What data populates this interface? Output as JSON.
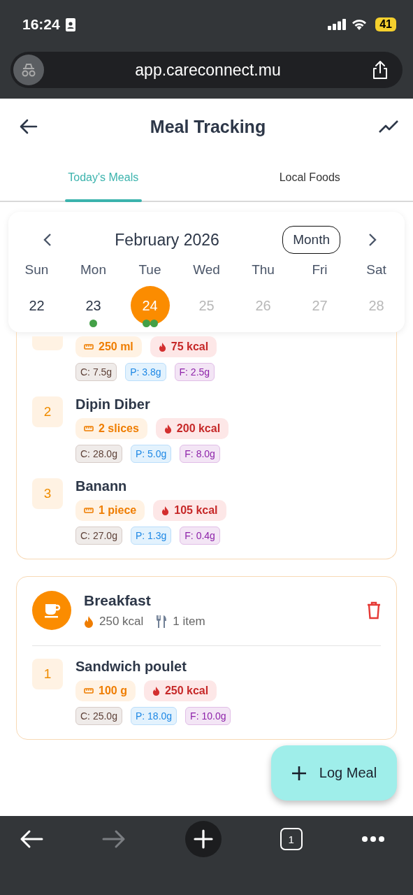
{
  "status_bar": {
    "time": "16:24",
    "battery": "41"
  },
  "browser": {
    "url": "app.careconnect.mu",
    "tab_count": "1"
  },
  "header": {
    "title": "Meal Tracking"
  },
  "tabs": [
    {
      "label": "Today's Meals",
      "selected": true
    },
    {
      "label": "Local Foods",
      "selected": false
    }
  ],
  "calendar": {
    "month": "February 2026",
    "view_button": "Month",
    "days": [
      {
        "weekday": "Sun",
        "date": "22",
        "selected": false,
        "disabled": false
      },
      {
        "weekday": "Mon",
        "date": "23",
        "selected": false,
        "disabled": false,
        "markers": [
          {
            "color": "#43a047"
          }
        ]
      },
      {
        "weekday": "Tue",
        "date": "24",
        "selected": true,
        "disabled": false,
        "markers": [
          {
            "color": "#43a047"
          },
          {
            "color": "#43a047"
          }
        ]
      },
      {
        "weekday": "Wed",
        "date": "25",
        "selected": false,
        "disabled": true
      },
      {
        "weekday": "Thu",
        "date": "26",
        "selected": false,
        "disabled": true
      },
      {
        "weekday": "Fri",
        "date": "27",
        "selected": false,
        "disabled": true
      },
      {
        "weekday": "Sat",
        "date": "28",
        "selected": false,
        "disabled": true
      }
    ]
  },
  "meals": [
    {
      "items": [
        {
          "portion": "250 ml",
          "calories": "75 kcal",
          "macros": [
            {
              "kind": "carbs",
              "text": "C: 7.5g"
            },
            {
              "kind": "protein",
              "text": "P: 3.8g"
            },
            {
              "kind": "fat",
              "text": "F: 2.5g"
            }
          ]
        },
        {
          "number": "2",
          "name": "Dipin Diber",
          "portion": "2 slices",
          "calories": "200 kcal",
          "macros": [
            {
              "kind": "carbs",
              "text": "C: 28.0g"
            },
            {
              "kind": "protein",
              "text": "P: 5.0g"
            },
            {
              "kind": "fat",
              "text": "F: 8.0g"
            }
          ]
        },
        {
          "number": "3",
          "name": "Banann",
          "portion": "1 piece",
          "calories": "105 kcal",
          "macros": [
            {
              "kind": "carbs",
              "text": "C: 27.0g"
            },
            {
              "kind": "protein",
              "text": "P: 1.3g"
            },
            {
              "kind": "fat",
              "text": "F: 0.4g"
            }
          ]
        }
      ]
    },
    {
      "title": "Breakfast",
      "calories": "250 kcal",
      "count": "1 item",
      "items": [
        {
          "number": "1",
          "name": "Sandwich poulet",
          "portion": "100 g",
          "calories": "250 kcal",
          "macros": [
            {
              "kind": "carbs",
              "text": "C: 25.0g"
            },
            {
              "kind": "protein",
              "text": "P: 18.0g"
            },
            {
              "kind": "fat",
              "text": "F: 10.0g"
            }
          ]
        }
      ]
    }
  ],
  "fab": {
    "label": "Log Meal"
  }
}
